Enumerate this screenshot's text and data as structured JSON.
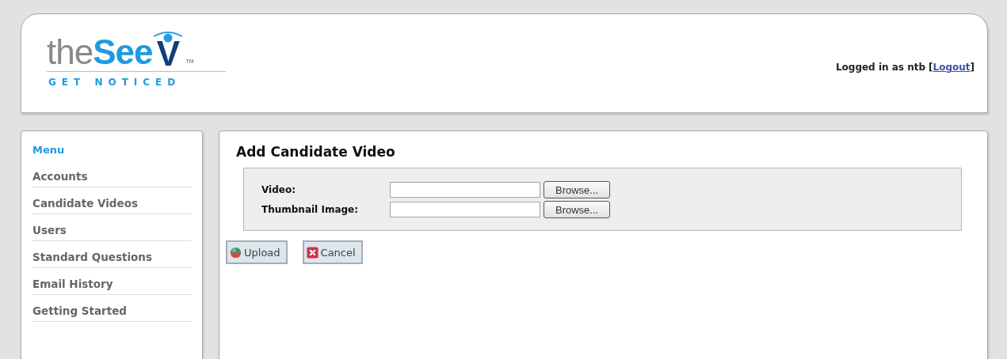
{
  "logo": {
    "prefix": "the",
    "brand": "See",
    "mark": "V",
    "trademark": "TM",
    "tagline": "GET NOTICED"
  },
  "login": {
    "text": "Logged in as ntb",
    "link": "Logout",
    "open": "[",
    "close": "]"
  },
  "sidebar": {
    "title": "Menu",
    "items": [
      {
        "label": "Accounts"
      },
      {
        "label": "Candidate Videos"
      },
      {
        "label": "Users"
      },
      {
        "label": "Standard Questions"
      },
      {
        "label": "Email History"
      },
      {
        "label": "Getting Started"
      }
    ]
  },
  "main": {
    "title": "Add Candidate Video",
    "fields": [
      {
        "label": "Video:",
        "button": "Browse..."
      },
      {
        "label": "Thumbnail Image:",
        "button": "Browse..."
      }
    ],
    "actions": [
      {
        "kind": "upload",
        "label": "Upload"
      },
      {
        "kind": "cancel",
        "label": "Cancel"
      }
    ]
  }
}
